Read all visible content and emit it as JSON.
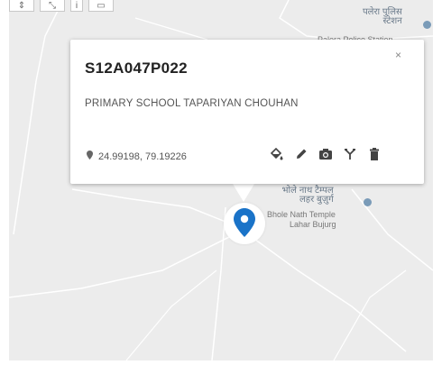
{
  "map": {
    "toolbar": [
      {
        "name": "tool-pan",
        "glyph": "⇕"
      },
      {
        "name": "tool-zoom",
        "glyph": "⤡"
      },
      {
        "name": "tool-info",
        "glyph": "i"
      },
      {
        "name": "tool-layers",
        "glyph": "▭"
      }
    ],
    "pois": [
      {
        "hi": "पलेरा पुलिस",
        "hi2": "स्टेशन",
        "en": "Palera Police Station"
      },
      {
        "hi": "भोले नाथ टैम्पल",
        "hi2": "लहर बुज़ुर्ग",
        "en": "Bhole Nath Temple",
        "en2": "Lahar Bujurg"
      }
    ],
    "colors": {
      "marker": "#1a73c8",
      "background": "#ececec",
      "road": "#ffffff"
    }
  },
  "popup": {
    "title": "S12A047P022",
    "close": "×",
    "description": "PRIMARY SCHOOL TAPARIYAN CHOUHAN",
    "coordinates": "24.99198, 79.19226",
    "actions": [
      "paint-bucket-icon",
      "pencil-icon",
      "camera-icon",
      "fork-icon",
      "trash-icon"
    ]
  }
}
